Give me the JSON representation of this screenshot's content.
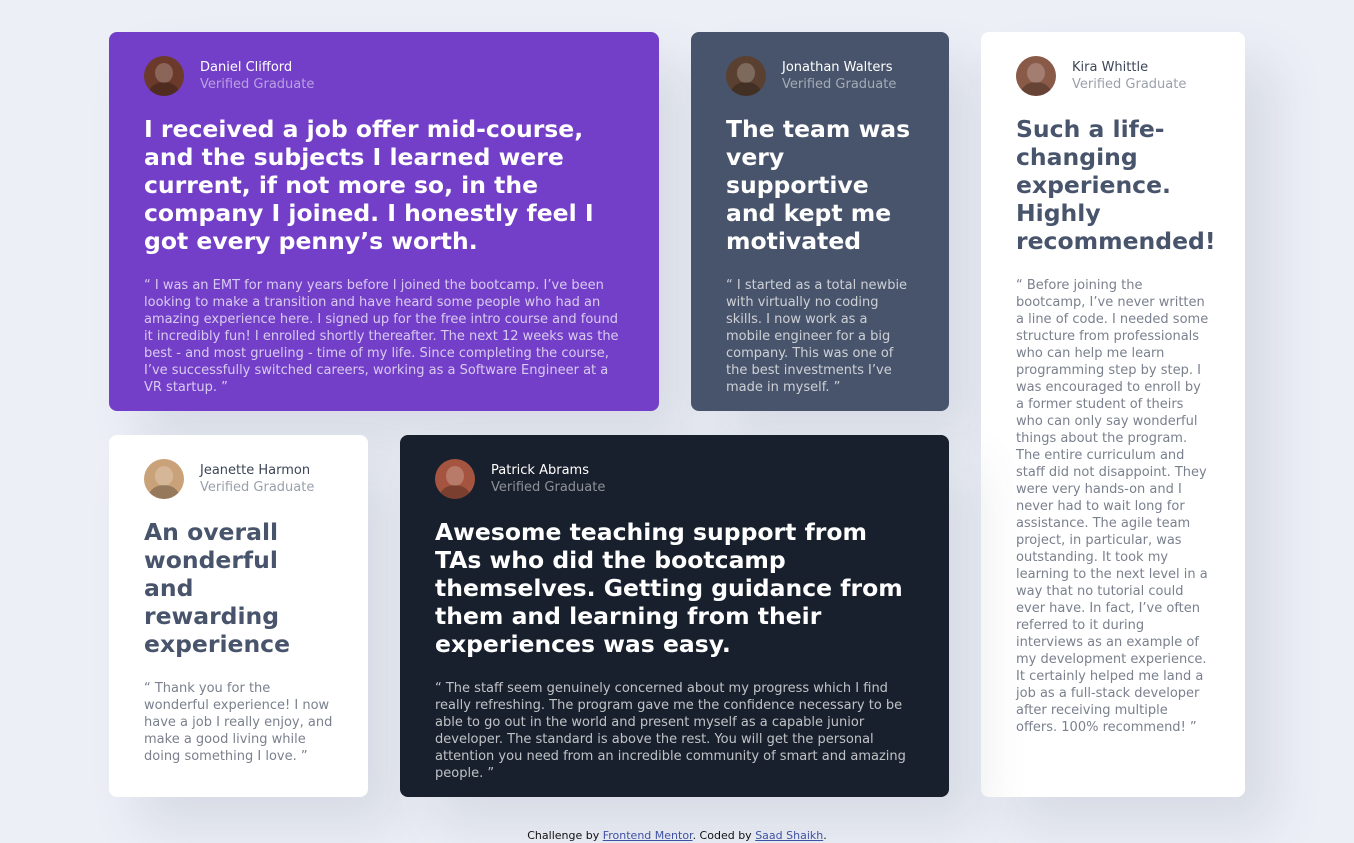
{
  "testimonials": [
    {
      "name": "Daniel Clifford",
      "role": "Verified Graduate",
      "avatar_color": "#6b3a2a",
      "headline": "I received a job offer mid-course, and the subjects I learned were current, if not more so, in the company I joined. I honestly feel I got every penny’s worth.",
      "quote": "“ I was an EMT for many years before I joined the bootcamp. I’ve been looking to make a transition and have heard some people who had an amazing experience here. I signed up for the free intro course and found it incredibly fun! I enrolled shortly thereafter. The next 12 weeks was the best - and most grueling - time of my life. Since completing the course, I’ve successfully switched careers, working as a Software Engineer at a VR startup. ”"
    },
    {
      "name": "Jonathan Walters",
      "role": "Verified Graduate",
      "avatar_color": "#5a4030",
      "headline": "The team was very supportive and kept me motivated",
      "quote": "“ I started as a total newbie with virtually no coding skills. I now work as a mobile engineer for a big company. This was one of the best investments I’ve made in myself. ”"
    },
    {
      "name": "Kira Whittle",
      "role": "Verified Graduate",
      "avatar_color": "#8a5a48",
      "headline": "Such a life-changing experience. Highly recommended!",
      "quote": "“ Before joining the bootcamp, I’ve never written a line of code. I needed some structure from professionals who can help me learn programming step by step. I was encouraged to enroll by a former student of theirs who can only say wonderful things about the program. The entire curriculum and staff did not disappoint. They were very hands-on and I never had to wait long for assistance. The agile team project, in particular, was outstanding. It took my learning to the next level in a way that no tutorial could ever have. In fact, I’ve often referred to it during interviews as an example of my development experience. It certainly helped me land a job as a full-stack developer after receiving multiple offers. 100% recommend! ”"
    },
    {
      "name": "Jeanette Harmon",
      "role": "Verified Graduate",
      "avatar_color": "#c9a27a",
      "headline": "An overall wonderful and rewarding experience",
      "quote": "“ Thank you for the wonderful experience! I now have a job I really enjoy, and make a good living while doing something I love. ”"
    },
    {
      "name": "Patrick Abrams",
      "role": "Verified Graduate",
      "avatar_color": "#a5553f",
      "headline": "Awesome teaching support from TAs who did the bootcamp themselves. Getting guidance from them and learning from their experiences was easy.",
      "quote": "“ The staff seem genuinely concerned about my progress which I find really refreshing. The program gave me the confidence necessary to be able to go out in the world and present myself as a capable junior developer. The standard is above the rest. You will get the personal attention you need from an incredible community of smart and amazing people. ”"
    }
  ],
  "footer": {
    "prefix": "Challenge by ",
    "challenge_link": "Frontend Mentor",
    "middle": ". Coded by ",
    "author_link": "Saad Shaikh",
    "suffix": "."
  }
}
